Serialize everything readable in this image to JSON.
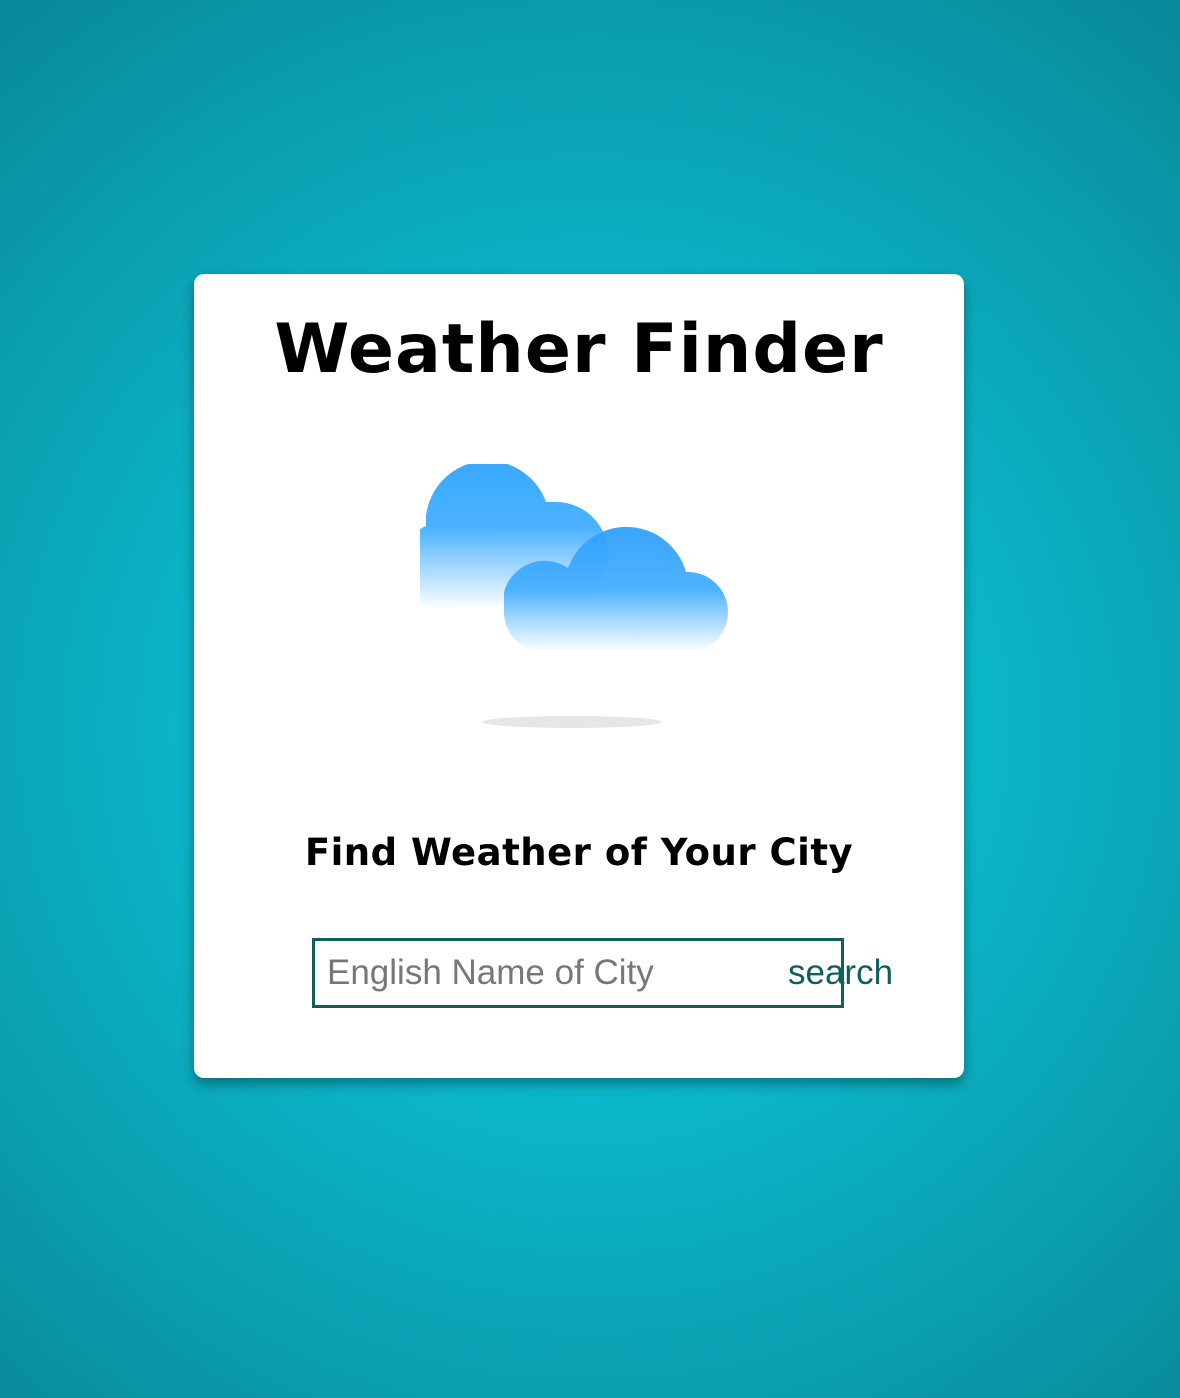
{
  "app": {
    "title": "Weather Finder",
    "subtitle": "Find Weather of Your City"
  },
  "illustration": {
    "icon": "cloud-icon",
    "cloud_color": "#38a9ff",
    "shadow_color": "#e6e6e6"
  },
  "search": {
    "placeholder": "English Name of City",
    "value": "",
    "button_label": "search"
  },
  "colors": {
    "background": "#0bbfd2",
    "card": "#ffffff",
    "accent": "#0f5f5c"
  }
}
